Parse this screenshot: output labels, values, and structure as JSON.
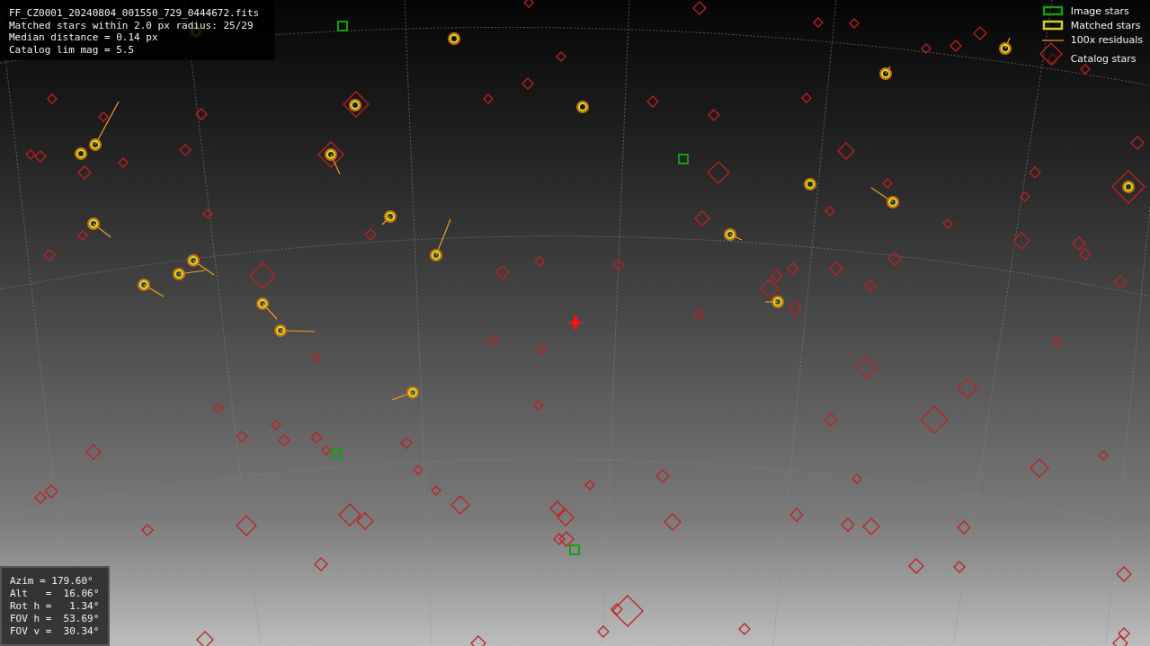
{
  "info_panel": {
    "lines": [
      "FF_CZ0001_20240804_001550_729_0444672.fits",
      "Matched stars within 2.0 px radius: 25/29",
      "Median distance = 0.14 px",
      "Catalog lim mag = 5.5"
    ]
  },
  "legend": [
    {
      "kind": "image",
      "label": "Image stars"
    },
    {
      "kind": "matched",
      "label": "Matched stars"
    },
    {
      "kind": "residual",
      "label": "100x residuals"
    },
    {
      "kind": "catalog",
      "label": "Catalog stars"
    }
  ],
  "pointing_panel": {
    "lines": [
      "Azim = 179.60°",
      "Alt   =  16.06°",
      "Rot h =   1.34°",
      "FOV h =  53.69°",
      "FOV v =  30.34°"
    ]
  }
}
